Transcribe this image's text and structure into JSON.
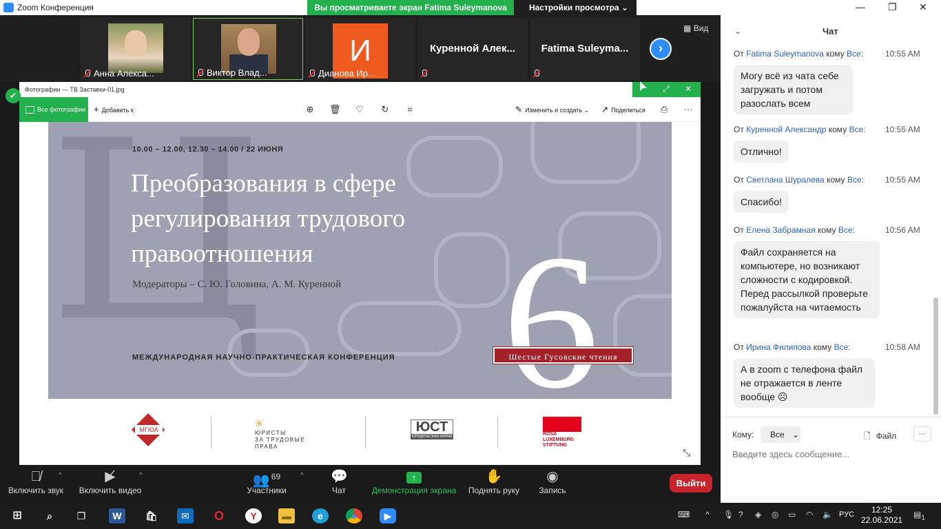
{
  "app": {
    "title": "Zoom Конференция"
  },
  "share_banner": {
    "text": "Вы просматриваете экран Fatima Suleymanova",
    "options": "Настройки просмотра ⌄"
  },
  "participants": [
    {
      "name": "Анна Алекса..."
    },
    {
      "name": "Виктор Влад..."
    },
    {
      "name": "Дианова Ир...",
      "avatar": "И"
    },
    {
      "name": "Куренной  Алек..."
    },
    {
      "name": "Fatima  Suleyma..."
    }
  ],
  "view": {
    "label": "Вид"
  },
  "photos_app": {
    "window_title": "Фотографии — ТВ Заставки-01.jpg",
    "all_photos": "Все фотографии",
    "add_to": "Добавить к",
    "edit_create": "Изменить и создать",
    "share": "Поделиться",
    "more": "···"
  },
  "slide": {
    "time": "10.00 – 12.00, 12.30 – 14.00 / 22 ИЮНЯ",
    "title": "Преобразования в сфере регулирования трудового правоотношения",
    "moderators": "Модераторы – С. Ю. Головина, А. М. Куренной",
    "conference": "МЕЖДУНАРОДНАЯ НАУЧНО-ПРАКТИЧЕСКАЯ КОНФЕРЕНЦИЯ",
    "number": "6",
    "badge": "Шестые Гусовские чтения",
    "bg_letter": "Ц"
  },
  "logos": {
    "mgua": "МГЮА",
    "jur1": "ЮРИСТЫ",
    "jur2": "ЗА ТРУДОВЫЕ",
    "jur3": "ПРАВА",
    "ust": "ЮСТ",
    "ust_sub": "ЮРИДИЧЕСКАЯ ФИРМА",
    "rosa1": "ROSA",
    "rosa2": "LUXEMBURG",
    "rosa3": "STIFTUNG"
  },
  "chat": {
    "title": "Чат",
    "messages": [
      {
        "from": "Fatima Suleymanova",
        "to_word": "кому",
        "to": "Все:",
        "time": "10:55 AM",
        "text": "Могу всё из чата себе загружать и потом разослать всем"
      },
      {
        "from": "Куренной Александр",
        "to_word": "кому",
        "to": "Все:",
        "time": "10:55 AM",
        "text": "Отлично!"
      },
      {
        "from": "Светлана Шуралева",
        "to_word": "кому",
        "to": "Все:",
        "time": "10:55 AM",
        "text": "Спасибо!"
      },
      {
        "from": "Елена Забрамная",
        "to_word": "кому",
        "to": "Все:",
        "time": "10:56 AM",
        "text": "Файл сохраняется на компьютере, но возникают сложности с кодировкой. Перед рассылкой проверьте пожалуйста на читаемость"
      },
      {
        "from": "Ирина Филипова",
        "to_word": "кому",
        "to": "Все:",
        "time": "10:58 AM",
        "text": "А в zoom с телефона файл не отражается в ленте вообще ☹"
      }
    ],
    "from_prefix": "От",
    "to_label": "Кому:",
    "to_value": "Все",
    "file": "Файл",
    "input_placeholder": "Введите здесь сообщение..."
  },
  "toolbar": {
    "audio": "Включить звук",
    "video": "Включить видео",
    "participants": "Участники",
    "participants_count": "69",
    "chat": "Чат",
    "share": "Демонстрация экрана",
    "raise_hand": "Поднять руку",
    "record": "Запись",
    "leave": "Выйти"
  },
  "taskbar": {
    "time": "12:25",
    "date": "22.06.2021",
    "lang": "РУС",
    "notifications": "1"
  },
  "colors": {
    "zoom_blue": "#2d8cff",
    "share_green": "#22b14c",
    "leave_red": "#c8222a",
    "slide_badge": "#a3222a"
  }
}
